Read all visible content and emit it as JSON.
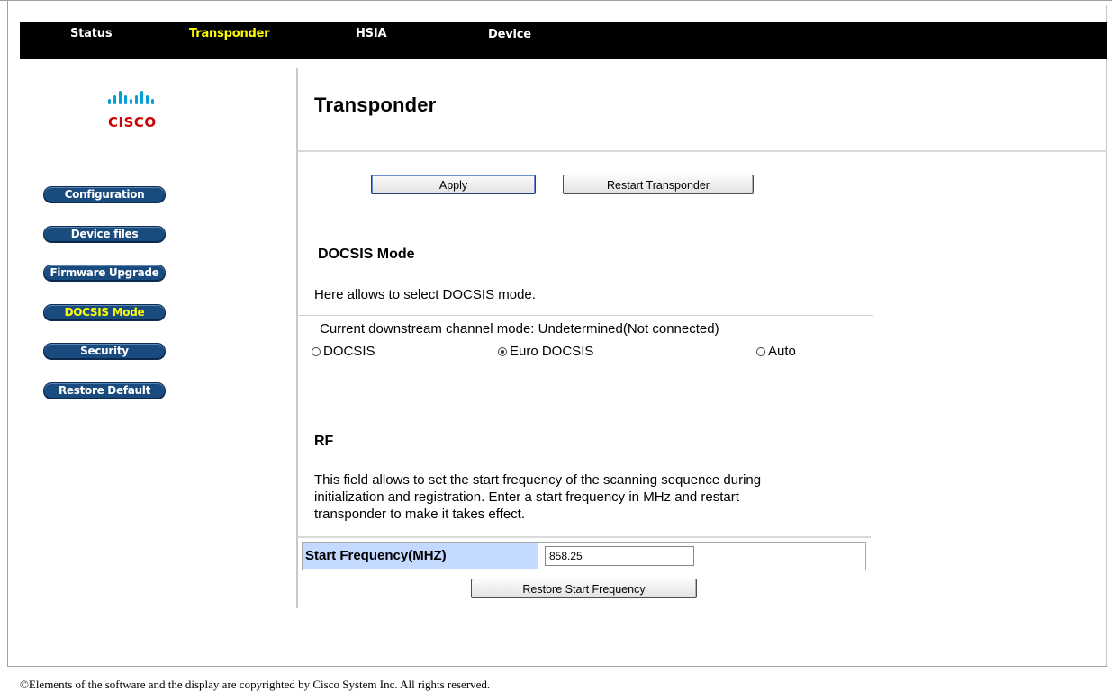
{
  "topnav": {
    "items": [
      "Status",
      "Transponder",
      "HSIA",
      "Device"
    ],
    "active": "Transponder"
  },
  "logo": {
    "text": "CISCO"
  },
  "sidebar": {
    "items": [
      {
        "label": "Configuration",
        "active": false
      },
      {
        "label": "Device files",
        "active": false
      },
      {
        "label": "Firmware Upgrade",
        "active": false
      },
      {
        "label": "DOCSIS Mode",
        "active": true
      },
      {
        "label": "Security",
        "active": false
      },
      {
        "label": "Restore Default",
        "active": false
      }
    ]
  },
  "main": {
    "title": "Transponder",
    "apply_label": "Apply",
    "restart_label": "Restart Transponder",
    "docsis": {
      "title": "DOCSIS Mode",
      "description": "Here allows to select DOCSIS mode.",
      "current_mode": "Current downstream channel mode: Undetermined(Not connected)",
      "options": [
        {
          "label": "DOCSIS",
          "checked": false
        },
        {
          "label": "Euro DOCSIS",
          "checked": true
        },
        {
          "label": "Auto",
          "checked": false
        }
      ]
    },
    "rf": {
      "title": "RF",
      "description_lines": [
        "This field allows to set the start frequency of the scanning sequence during",
        "initialization and registration. Enter a start frequency in MHz and restart",
        "transponder to make it takes effect."
      ],
      "freq_label": "Start Frequency(MHZ)",
      "freq_value": "858.25",
      "restore_label": "Restore Start Frequency"
    }
  },
  "footer": "©Elements of the software and the display are copyrighted by Cisco System Inc. All rights reserved.",
  "colors": {
    "nav_bg": "#000000",
    "nav_active": "#ffff00",
    "sidebar_button": "#1a4b7e",
    "freq_label_bg": "#c3d9ff",
    "logo_red": "#cc0000",
    "logo_blue": "#049fd9"
  }
}
